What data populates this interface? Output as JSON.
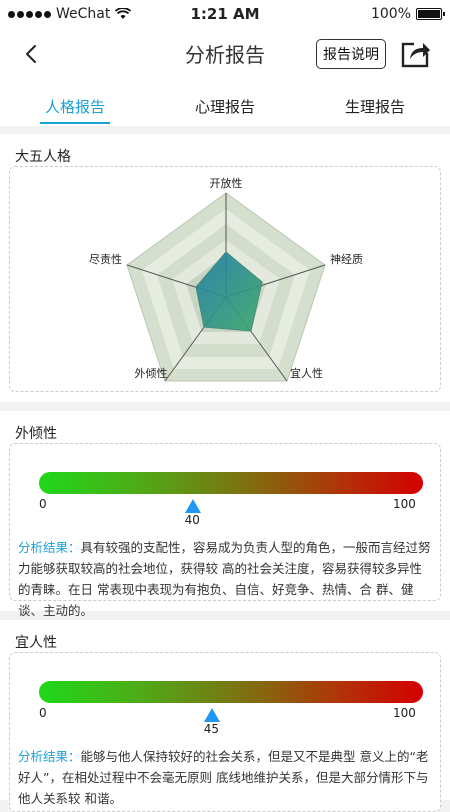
{
  "status": {
    "carrier": "WeChat",
    "time": "1:21 AM",
    "battery": "100%"
  },
  "nav": {
    "title": "分析报告",
    "report_button": "报告说明"
  },
  "tabs": [
    {
      "label": "人格报告",
      "active": true
    },
    {
      "label": "心理报告",
      "active": false
    },
    {
      "label": "生理报告",
      "active": false
    }
  ],
  "big_five": {
    "title": "大五人格",
    "axes": [
      "开放性",
      "神经质",
      "宜人性",
      "外倾性",
      "尽责性"
    ]
  },
  "sections": [
    {
      "title": "外倾性",
      "min": "0",
      "max": "100",
      "value": 40,
      "value_label": "40",
      "analysis_label": "分析结果：",
      "analysis_text": "具有较强的支配性，容易成为负责人型的角色，一般而言经过努力能够获取较高的社会地位，获得较 高的社会关注度，容易获得较多异性的青睐。在日 常表现中表现为有抱负、自信、好竞争、热情、合 群、健谈、主动的。"
    },
    {
      "title": "宜人性",
      "min": "0",
      "max": "100",
      "value": 45,
      "value_label": "45",
      "analysis_label": "分析结果：",
      "analysis_text": "能够与他人保持较好的社会关系，但是又不是典型 意义上的“老好人”，在相处过程中不会毫无原则 底线地维护关系，但是大部分情形下与他人关系较 和谐。"
    }
  ],
  "colors": {
    "accent": "#1aa1d6",
    "marker": "#2196f3",
    "bar_start": "#1fd81a",
    "bar_end": "#d40000"
  }
}
